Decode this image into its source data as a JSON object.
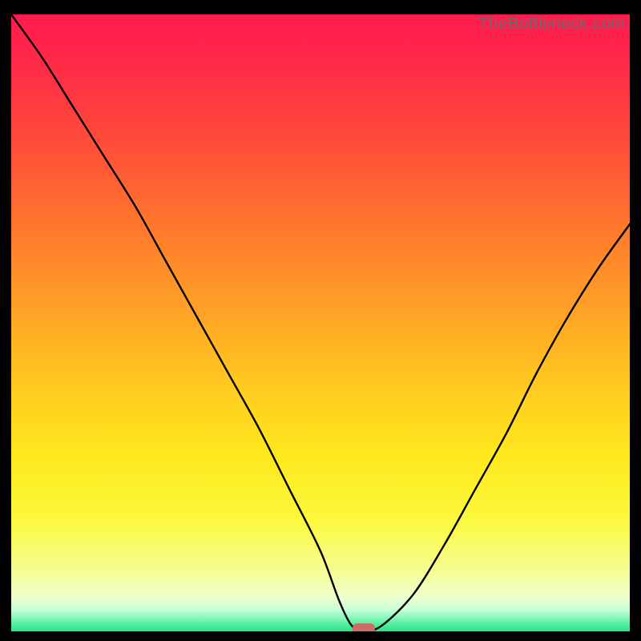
{
  "watermark": "TheBottleneck.com",
  "colors": {
    "frame": "#000000",
    "curve": "#000000",
    "marker": "#cb6f65",
    "gradient_stops": [
      {
        "offset": 0.0,
        "color": "#ff1a4e"
      },
      {
        "offset": 0.1,
        "color": "#ff2f45"
      },
      {
        "offset": 0.22,
        "color": "#ff5038"
      },
      {
        "offset": 0.35,
        "color": "#ff7a2c"
      },
      {
        "offset": 0.48,
        "color": "#ffa226"
      },
      {
        "offset": 0.6,
        "color": "#ffc91f"
      },
      {
        "offset": 0.72,
        "color": "#ffe91e"
      },
      {
        "offset": 0.82,
        "color": "#fbf93e"
      },
      {
        "offset": 0.9,
        "color": "#f6fd91"
      },
      {
        "offset": 0.945,
        "color": "#eeffce"
      },
      {
        "offset": 0.965,
        "color": "#c7ffd7"
      },
      {
        "offset": 0.985,
        "color": "#63f2a8"
      },
      {
        "offset": 1.0,
        "color": "#27e389"
      }
    ]
  },
  "chart_data": {
    "type": "line",
    "title": "",
    "xlabel": "",
    "ylabel": "",
    "xlim": [
      0,
      100
    ],
    "ylim": [
      0,
      100
    ],
    "series": [
      {
        "name": "bottleneck-curve",
        "x": [
          0,
          5,
          10,
          15,
          20,
          25,
          30,
          35,
          40,
          45,
          50,
          53,
          55,
          57,
          60,
          65,
          70,
          75,
          80,
          85,
          90,
          95,
          100
        ],
        "y": [
          100,
          93,
          85,
          77,
          69,
          60,
          51,
          42,
          33,
          23,
          13,
          5,
          1,
          0,
          1,
          6,
          14,
          23,
          32,
          42,
          51,
          59,
          66
        ]
      }
    ],
    "marker": {
      "x": 57,
      "y": 0
    }
  }
}
